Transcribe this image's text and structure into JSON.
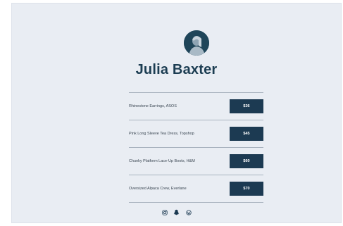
{
  "profile": {
    "name": "Julia Baxter"
  },
  "items": [
    {
      "label": "Rhinestone Earrings, ASOS",
      "price": "$36"
    },
    {
      "label": "Pink Long Sleeve Tea Dress, Topshop",
      "price": "$45"
    },
    {
      "label": "Chunky Platform Lace-Up Boots, H&M",
      "price": "$60"
    },
    {
      "label": "Oversized Alpaca Crew, Everlane",
      "price": "$70"
    }
  ],
  "socials": {
    "icons": [
      "instagram-icon",
      "snapchat-icon",
      "wordpress-icon"
    ]
  },
  "colors": {
    "background": "#e9edf3",
    "accent": "#1c3a52",
    "title": "#1c3d52"
  }
}
